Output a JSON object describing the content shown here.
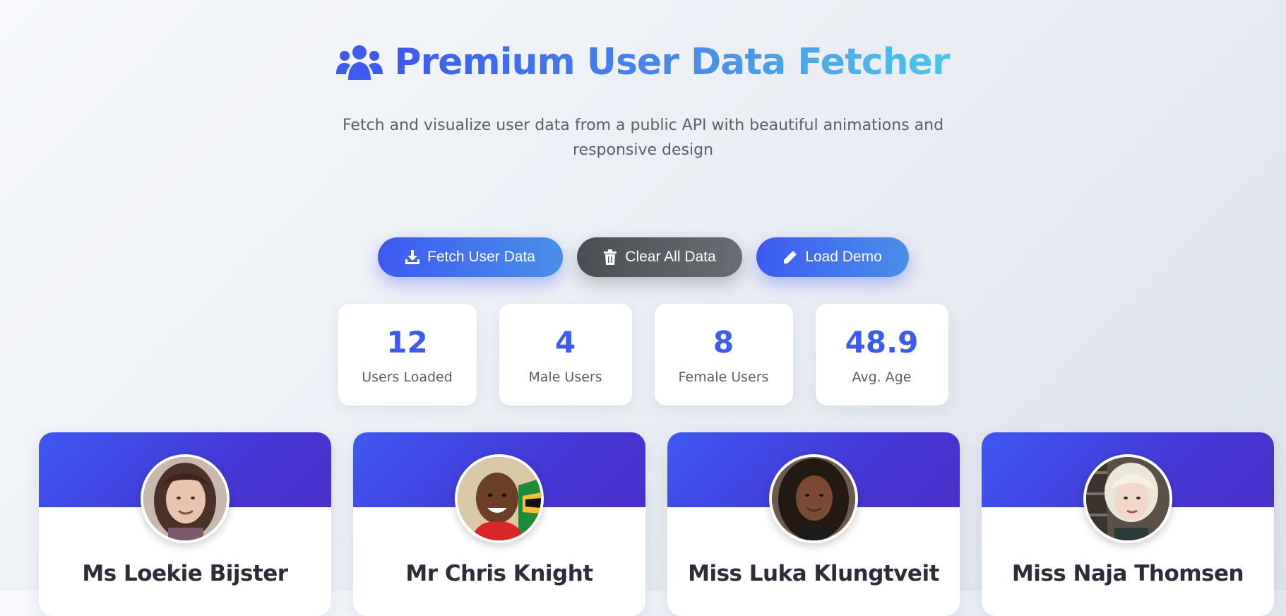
{
  "header": {
    "title": "Premium User Data Fetcher",
    "icon": "users-icon",
    "subtitle": "Fetch and visualize user data from a public API with beautiful animations and responsive design"
  },
  "actions": {
    "fetch_label": "Fetch User Data",
    "clear_label": "Clear All Data",
    "demo_label": "Load Demo"
  },
  "stats": [
    {
      "value": "12",
      "label": "Users Loaded"
    },
    {
      "value": "4",
      "label": "Male Users"
    },
    {
      "value": "8",
      "label": "Female Users"
    },
    {
      "value": "48.9",
      "label": "Avg. Age"
    }
  ],
  "users": [
    {
      "name": "Ms Loekie Bijster"
    },
    {
      "name": "Mr Chris Knight"
    },
    {
      "name": "Miss Luka Klungtveit"
    },
    {
      "name": "Miss Naja Thomsen"
    }
  ],
  "colors": {
    "accent": "#3d5af1",
    "accent_light": "#4cc6ec",
    "card_banner": "#4438d6",
    "dark_button": "#4a4d52"
  }
}
